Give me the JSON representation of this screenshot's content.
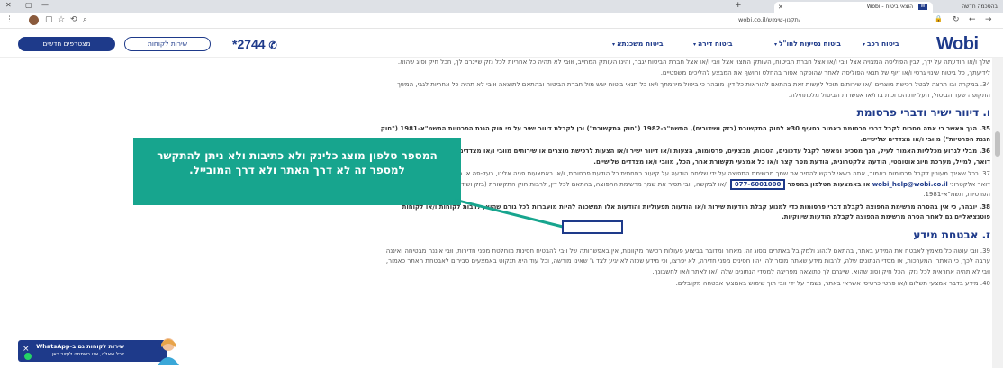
{
  "browser": {
    "active_tab_title": "הוצאי ביטוח - Wobi",
    "active_tab_fav": "W",
    "other_tab_title": "בהסכמה חדשה",
    "url": "wobi.co.il/תקנון-שימוש/",
    "new_tab_label": "+"
  },
  "header": {
    "logo": "Wobi",
    "nav": [
      {
        "label": "ביטוח רכב"
      },
      {
        "label": "ביטוח נסיעות לחו\"ל"
      },
      {
        "label": "ביטוח דירה"
      },
      {
        "label": "ביטוח משכנתא"
      }
    ],
    "phone": "*2744",
    "service_button": "שירות לקוחות",
    "quote_button": "מצטרפים חדשים"
  },
  "content": {
    "intro": "שלך ו/או הודעתה על ידך, לבין הפוליסה המצויה אצל ווּבי ו/או אצל חברת הביטוח, העותק המצוי אצל ווּבי ו/או אצל חברת הביטוח יגבר, והינו העותק המחייב, וּווּבי לא תהיה כל אחריות לכל נזק שייגרם לך, חכל חיק וסוג שהוא. לידיעתך, כל ביטוח שינוי גרסי ו/או זיוף של תנאי הפוליסה לאחר שהופקה אסור בהחלט וחושף את המבצע להליכים משפטיים.",
    "p34": "34. במקרה ובו תרצה לבטל רכישת מוצרים ו/או שירותים תוכל לעשות זאת בהתאם להוראות כל דין. מובהר כי ביטול מיוזמתך ו/או כל תנאי ביטוח יוגש מול חברת הביטוח ובהתאם לתוצאה וּווּבי לא תהיה כל אחריות לגבי, המשך התקופה שעד הביטול, העלויות הכרוכות בו ו/או אפשרות הביטול מלכתחילה.",
    "h_v": "ו. דיוור ישיר ודברי פרסומת",
    "p35": "35. הנך מאשר כי אתה מסכים לקבל דברי פרסומת כאמור בסעיף 30א לחוק התקשורת (בזק ושידורים), התשמ\"ב-1982 (\"חוק התקשורת\") וכן לקבלת דיוור ישיר על פי חוק הגנת הפרטיות התשמ\"א-1981 (\"חוק הגנת הפרטיות\") מווּבי ו/או מצדדים שלישיים.",
    "p36": "36. מבלי לגרוע מכלליות האמור לעיל, הנך מסכים ומאשר לקבל עדכונים, הטבות, מבצעים, פרסומות, הצעות ו/או דיוור ישיר ו/או הצעות לרכישת מוצרים או שירותים מווּבי ו/או מצדדים שלישיים, לרבות באמצעות דואר, למייל, מערכת חיוג אוטומטי, הודעה אלקטרונית, הודעת מסר קצר ו/או כל אמצעי תקשורת אחר, הכל, מווּבי ו/או מצדדים שלישיים.",
    "p37_a": "37. ככל שאינך מעוניין לקבל פרסומות כאמור, אתה רשאי לבקש להסיר את שמך מרשימת התפוצה על ידי שליחת הודעה על קיעור בתחתית כל הודעת פרסומת, ו/או באמצעות פניה אלינו, בעל-פה או בכתב, לרבות באמצעות כתובת דואר אלקטרוני",
    "p37_email": "wobi_help@wobi.co.il",
    "p37_b": "או באמצעות הטלפון במספר",
    "p37_phone": "077-6001000",
    "p37_c": "ו/או לבקשה, ווּבי תסיר את שמך מרשימת התפוצה, בהתאם לכל דין, לרבות חוק התקשורת (בזק ושידורים), תשמ\"ב-1982 וחוק הגנת הפרטיות, תשמ\"א-1981.",
    "p38": "38. יובהר, כי אין בהסרה מרשימת התפוצה לקבלת דברי פרסומות כדי למנוע קבלת הודעות שירות ו/או הודעות תפעוליות והודעות אלו תמשכנה להיות מועברות לכל גורם שהוא, לרבות לקוחות ו/או לקוחות פוטנציאליים גם לאחר הסרה מרשימת התפוצה לקבלת הודעות שיווקיות.",
    "h_z": "ז. אבטחת מידע",
    "p39": "39. ווּבי עושה כל מאמץ לאבטח את המידע באתר, בהתאם לנהוג ולמקובל באתרים מסוג זה. מאחר ומדובר בביצוע פעולות רכישה מקוונות, אין באפשרותה של ווּבי להבטיח חסינות מוחלטת מפני חדירות, ווּבי איננה מבטיחה ואיננה ערבה לכך, כי האתר, המערכות, או מסדי הנתונים שלה, לרבות מידע שאתה מוסר לה, יהיו חסינים מפני חדירה, לא יפרצו, וכי מידע שכזה לא יגיע לצד ג' שאינו מורשה, וכל עוד היא תנקוט באמצעים סבירים לאבטחת האתר כאמור, ווּבי לא תהיה אחראית לכל נזק, הכל חיק וסוג שהוא, שייגרם לך כתוצאה מפריצה למסדי הנתונים שלה ו/או לאתר ו/או לחשבונך.",
    "p40": "40. מידע בדבר אמצעי תשלום ו/או פרטי כרטיסי אשראי באתר, נשמר על ידי ווּבי תוך שימוש באמצעי אבטחה מקובלים."
  },
  "overlay": {
    "text": "המספר טלפון מוצג כלינק ולא כתיבות ולא ניתן להתקשר למספר זה לא דרך האתר ולא דרך המובייל."
  },
  "chat": {
    "title": "שירות לקוחות גם ב-WhatsApp",
    "subtitle": "לכל שאלה, אנו בשמחה לעזור כאן",
    "close": "×"
  }
}
